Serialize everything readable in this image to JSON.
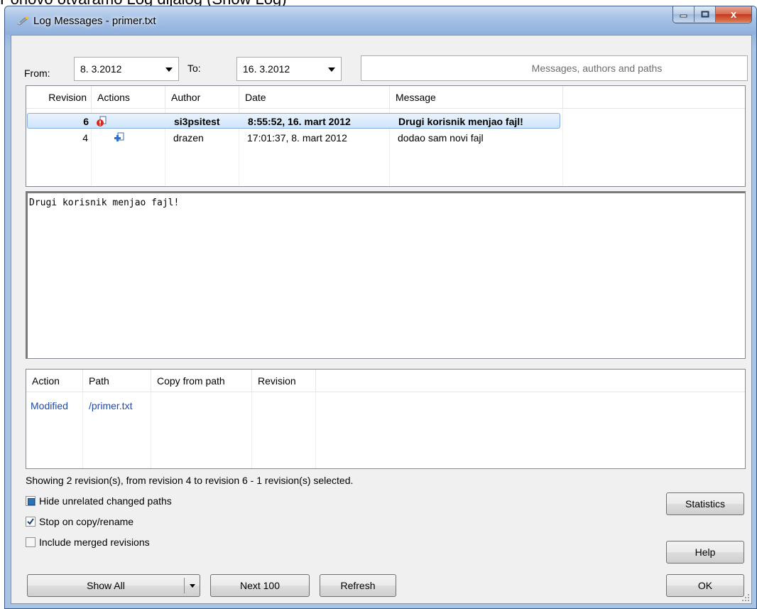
{
  "page_above_text": "Ponovo otvaramo Log dijalog (Show Log)",
  "window": {
    "title": "Log Messages - primer.txt",
    "controls": {
      "minimize": "–",
      "maximize": "□",
      "close": "x"
    }
  },
  "filters": {
    "from_label": "From:",
    "from_value": "8. 3.2012",
    "to_label": "To:",
    "to_value": "16. 3.2012",
    "search_placeholder": "Messages, authors and paths"
  },
  "revisions": {
    "columns": [
      "Revision",
      "Actions",
      "Author",
      "Date",
      "Message"
    ],
    "rows": [
      {
        "revision": "6",
        "action_icon": "modified-conflict-icon",
        "author": "si3psitest",
        "date": "8:55:52, 16. mart 2012",
        "message": "Drugi korisnik menjao fajl!",
        "selected": true
      },
      {
        "revision": "4",
        "action_icon": "added-file-icon",
        "author": "drazen",
        "date": "17:01:37, 8. mart 2012",
        "message": "dodao sam novi fajl",
        "selected": false
      }
    ]
  },
  "message_text": "Drugi korisnik menjao fajl!",
  "paths": {
    "columns": [
      "Action",
      "Path",
      "Copy from path",
      "Revision"
    ],
    "rows": [
      {
        "action": "Modified",
        "path": "/primer.txt",
        "copy_from": "",
        "revision": ""
      }
    ]
  },
  "status_text": "Showing 2 revision(s), from revision 4 to revision 6 - 1 revision(s) selected.",
  "options": {
    "hide_unrelated": {
      "label": "Hide unrelated changed paths",
      "state": "indeterminate"
    },
    "stop_on_copy": {
      "label": "Stop on copy/rename",
      "state": "checked"
    },
    "include_merged": {
      "label": "Include merged revisions",
      "state": "unchecked"
    }
  },
  "buttons": {
    "show_all": "Show All",
    "next_100": "Next 100",
    "refresh": "Refresh",
    "statistics": "Statistics",
    "help": "Help",
    "ok": "OK"
  },
  "colors": {
    "path_text": "#1f4aa8",
    "selection_border": "#84acdd",
    "titlebar": "#a4c0e5"
  }
}
